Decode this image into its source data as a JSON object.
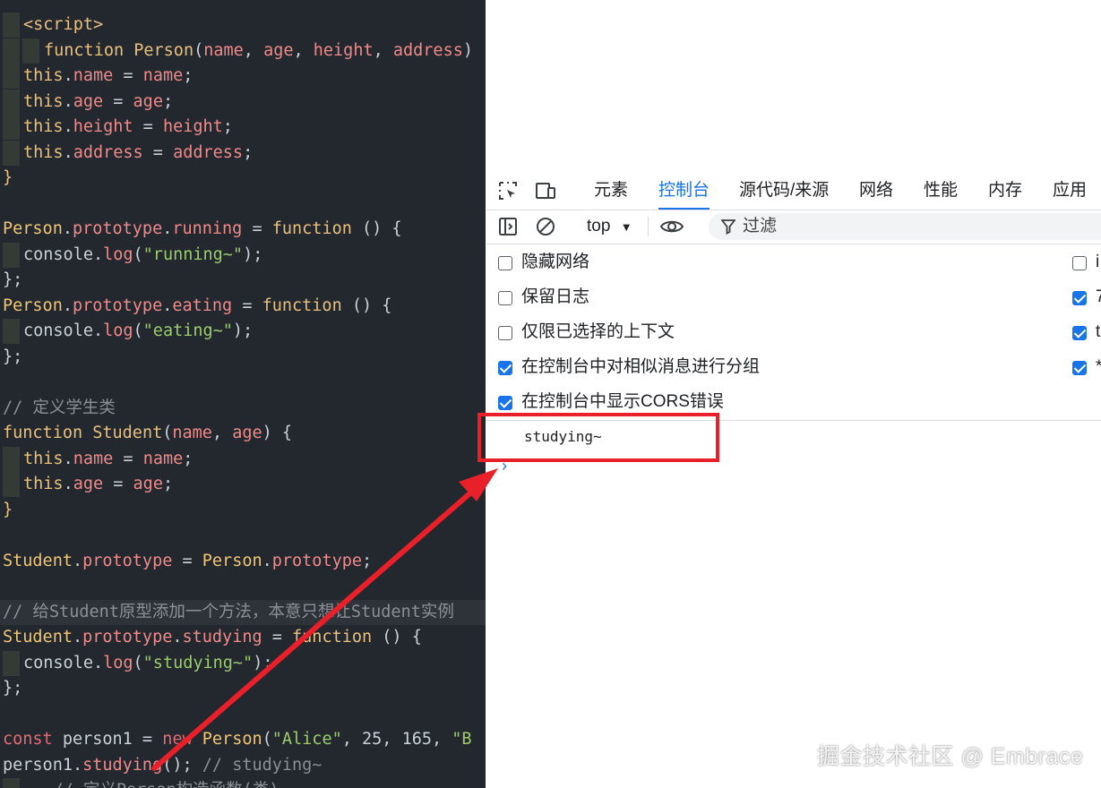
{
  "editor": {
    "lines": [
      {
        "segs": [
          [
            "tag",
            "<script>"
          ]
        ],
        "indent": 1
      },
      {
        "segs": [
          [
            "kw",
            "function "
          ],
          [
            "fn",
            "Person"
          ],
          [
            "pl",
            "("
          ],
          [
            "prop",
            "name"
          ],
          [
            "pl",
            ", "
          ],
          [
            "prop",
            "age"
          ],
          [
            "pl",
            ", "
          ],
          [
            "prop",
            "height"
          ],
          [
            "pl",
            ", "
          ],
          [
            "prop",
            "address"
          ],
          [
            "pl",
            ")"
          ]
        ],
        "indent": 2
      },
      {
        "segs": [
          [
            "th",
            "this"
          ],
          [
            "pl",
            "."
          ],
          [
            "prop",
            "name"
          ],
          [
            "pl",
            " = "
          ],
          [
            "prop",
            "name"
          ],
          [
            "pl",
            ";"
          ]
        ],
        "indent": 1
      },
      {
        "segs": [
          [
            "th",
            "this"
          ],
          [
            "pl",
            "."
          ],
          [
            "prop",
            "age"
          ],
          [
            "pl",
            " = "
          ],
          [
            "prop",
            "age"
          ],
          [
            "pl",
            ";"
          ]
        ],
        "indent": 1
      },
      {
        "segs": [
          [
            "th",
            "this"
          ],
          [
            "pl",
            "."
          ],
          [
            "prop",
            "height"
          ],
          [
            "pl",
            " = "
          ],
          [
            "prop",
            "height"
          ],
          [
            "pl",
            ";"
          ]
        ],
        "indent": 1
      },
      {
        "segs": [
          [
            "th",
            "this"
          ],
          [
            "pl",
            "."
          ],
          [
            "prop",
            "address"
          ],
          [
            "pl",
            " = "
          ],
          [
            "prop",
            "address"
          ],
          [
            "pl",
            ";"
          ]
        ],
        "indent": 1
      },
      {
        "segs": [
          [
            "tag",
            "}"
          ]
        ],
        "indent": 0
      },
      {
        "segs": [],
        "indent": 0
      },
      {
        "segs": [
          [
            "id",
            "Person"
          ],
          [
            "pl",
            "."
          ],
          [
            "prop",
            "prototype"
          ],
          [
            "pl",
            "."
          ],
          [
            "prop",
            "running"
          ],
          [
            "pl",
            " = "
          ],
          [
            "kw",
            "function"
          ],
          [
            "pl",
            " () {"
          ]
        ],
        "indent": 0
      },
      {
        "segs": [
          [
            "pl",
            "console"
          ],
          [
            "pl",
            "."
          ],
          [
            "prop",
            "log"
          ],
          [
            "pl",
            "("
          ],
          [
            "str",
            "\"running~\""
          ],
          [
            "pl",
            ");"
          ]
        ],
        "indent": 1
      },
      {
        "segs": [
          [
            "pl",
            "};"
          ]
        ],
        "indent": 0
      },
      {
        "segs": [
          [
            "id",
            "Person"
          ],
          [
            "pl",
            "."
          ],
          [
            "prop",
            "prototype"
          ],
          [
            "pl",
            "."
          ],
          [
            "prop",
            "eating"
          ],
          [
            "pl",
            " = "
          ],
          [
            "kw",
            "function"
          ],
          [
            "pl",
            " () {"
          ]
        ],
        "indent": 0
      },
      {
        "segs": [
          [
            "pl",
            "console"
          ],
          [
            "pl",
            "."
          ],
          [
            "prop",
            "log"
          ],
          [
            "pl",
            "("
          ],
          [
            "str",
            "\"eating~\""
          ],
          [
            "pl",
            ");"
          ]
        ],
        "indent": 1
      },
      {
        "segs": [
          [
            "pl",
            "};"
          ]
        ],
        "indent": 0
      },
      {
        "segs": [],
        "indent": 0
      },
      {
        "segs": [
          [
            "cm",
            "// 定义学生类"
          ]
        ],
        "indent": 0
      },
      {
        "segs": [
          [
            "kw",
            "function "
          ],
          [
            "fn",
            "Student"
          ],
          [
            "pl",
            "("
          ],
          [
            "prop",
            "name"
          ],
          [
            "pl",
            ", "
          ],
          [
            "prop",
            "age"
          ],
          [
            "pl",
            ") {"
          ]
        ],
        "indent": 0
      },
      {
        "segs": [
          [
            "th",
            "this"
          ],
          [
            "pl",
            "."
          ],
          [
            "prop",
            "name"
          ],
          [
            "pl",
            " = "
          ],
          [
            "prop",
            "name"
          ],
          [
            "pl",
            ";"
          ]
        ],
        "indent": 1
      },
      {
        "segs": [
          [
            "th",
            "this"
          ],
          [
            "pl",
            "."
          ],
          [
            "prop",
            "age"
          ],
          [
            "pl",
            " = "
          ],
          [
            "prop",
            "age"
          ],
          [
            "pl",
            ";"
          ]
        ],
        "indent": 1
      },
      {
        "segs": [
          [
            "tag",
            "}"
          ]
        ],
        "indent": 0
      },
      {
        "segs": [],
        "indent": 0
      },
      {
        "segs": [
          [
            "id",
            "Student"
          ],
          [
            "pl",
            "."
          ],
          [
            "prop",
            "prototype"
          ],
          [
            "pl",
            " = "
          ],
          [
            "id",
            "Person"
          ],
          [
            "pl",
            "."
          ],
          [
            "prop",
            "prototype"
          ],
          [
            "pl",
            ";"
          ]
        ],
        "indent": 0
      },
      {
        "segs": [],
        "indent": 0
      },
      {
        "segs": [
          [
            "cm",
            "// 给Student原型添加一个方法，本意只想让Student实例"
          ]
        ],
        "indent": 0,
        "hl": true
      },
      {
        "segs": [
          [
            "id",
            "Student"
          ],
          [
            "pl",
            "."
          ],
          [
            "prop",
            "prototype"
          ],
          [
            "pl",
            "."
          ],
          [
            "prop",
            "studying"
          ],
          [
            "pl",
            " = "
          ],
          [
            "kw",
            "function"
          ],
          [
            "pl",
            " () {"
          ]
        ],
        "indent": 0
      },
      {
        "segs": [
          [
            "pl",
            "console"
          ],
          [
            "pl",
            "."
          ],
          [
            "prop",
            "log"
          ],
          [
            "pl",
            "("
          ],
          [
            "str",
            "\"studying~\""
          ],
          [
            "pl",
            ");"
          ]
        ],
        "indent": 1
      },
      {
        "segs": [
          [
            "pl",
            "};"
          ]
        ],
        "indent": 0
      },
      {
        "segs": [],
        "indent": 0
      },
      {
        "segs": [
          [
            "kw2",
            "const "
          ],
          [
            "pl",
            "person1 = "
          ],
          [
            "kw2",
            "new "
          ],
          [
            "id",
            "Person"
          ],
          [
            "pl",
            "("
          ],
          [
            "str",
            "\"Alice\""
          ],
          [
            "pl",
            ", "
          ],
          [
            "num",
            "25"
          ],
          [
            "pl",
            ", "
          ],
          [
            "num",
            "165"
          ],
          [
            "pl",
            ", "
          ],
          [
            "str",
            "\"B"
          ]
        ],
        "indent": 0
      },
      {
        "segs": [
          [
            "pl",
            "person1"
          ],
          [
            "pl",
            "."
          ],
          [
            "prop",
            "studying"
          ],
          [
            "pl",
            "(); "
          ],
          [
            "cm",
            "// studying~"
          ]
        ],
        "indent": 0
      },
      {
        "segs": [
          [
            "cm",
            "   // 定义Person构造函数(类)"
          ]
        ],
        "indent": 1
      }
    ]
  },
  "devtools": {
    "tabs": [
      "元素",
      "控制台",
      "源代码/来源",
      "网络",
      "性能",
      "内存",
      "应用"
    ],
    "active_tab": "控制台",
    "context": "top",
    "filter_placeholder": "过滤",
    "settings_left": [
      {
        "label": "隐藏网络",
        "checked": false
      },
      {
        "label": "保留日志",
        "checked": false
      },
      {
        "label": "仅限已选择的上下文",
        "checked": false
      },
      {
        "label": "在控制台中对相似消息进行分组",
        "checked": true
      },
      {
        "label": "在控制台中显示CORS错误",
        "checked": true
      }
    ],
    "settings_right_partial": [
      {
        "label": "i",
        "checked": false
      },
      {
        "label": "7",
        "checked": true
      },
      {
        "label": "t",
        "checked": true
      },
      {
        "label": "*",
        "checked": true
      }
    ],
    "console_output": "studying~",
    "prompt": "›"
  },
  "annotation": {
    "color": "#e8202a"
  },
  "watermark": "掘金技术社区 @ Embrace"
}
